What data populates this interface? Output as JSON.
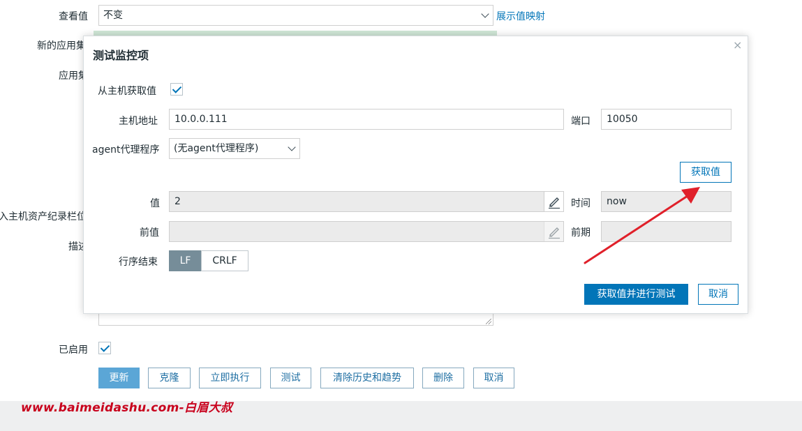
{
  "form": {
    "view_value_label": "查看值",
    "view_value_select": "不变",
    "show_value_mapping_link": "展示值映射",
    "new_app_set_label": "新的应用集",
    "app_set_label": "应用集",
    "inventory_field_label": "入主机资产纪录栏位",
    "description_label": "描述",
    "enabled_label": "已启用",
    "buttons": {
      "update": "更新",
      "clone": "克隆",
      "execute_now": "立即执行",
      "test": "测试",
      "clear_history": "清除历史和趋势",
      "delete": "删除",
      "cancel": "取消"
    }
  },
  "dialog": {
    "title": "测试监控项",
    "close": "×",
    "get_from_host_label": "从主机获取值",
    "host_address_label": "主机地址",
    "host_address_value": "10.0.0.111",
    "port_label": "端口",
    "port_value": "10050",
    "proxy_label": "agent代理程序",
    "proxy_value": "(无agent代理程序)",
    "get_value_button": "获取值",
    "value_label": "值",
    "value_value": "2",
    "time_label": "时间",
    "time_value": "now",
    "prev_value_label": "前值",
    "prev_value_value": "",
    "prev_time_label": "前期",
    "prev_time_value": "",
    "eol_label": "行序结束",
    "eol_lf": "LF",
    "eol_crlf": "CRLF",
    "get_and_test_button": "获取值并进行测试",
    "cancel_button": "取消"
  },
  "watermark": "www.baimeidashu.com-白眉大叔",
  "colors": {
    "accent": "#0275b8",
    "update_button": "#5ba6d6",
    "segment_active": "#768d99",
    "arrow": "#e0202a",
    "watermark": "#c8001c"
  }
}
